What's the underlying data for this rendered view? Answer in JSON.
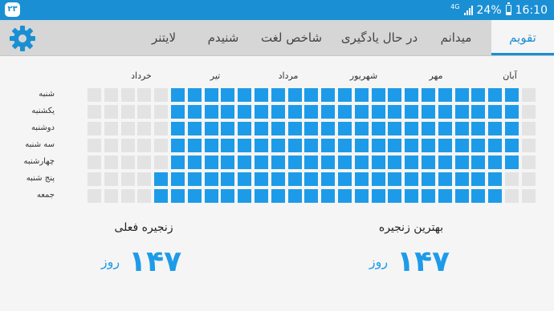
{
  "status_bar": {
    "app_badge": "۲۳",
    "network": "4G",
    "battery": "24%",
    "time": "16:10"
  },
  "tabs": {
    "calendar": "تقویم",
    "did_you_know": "میدانم",
    "learning": "در حال یادگیری",
    "word_index": "شاخص لغت",
    "heard": "شنیدم",
    "leitner": "لایتنر"
  },
  "calendar": {
    "months": {
      "aban": "آبان",
      "mehr": "مهر",
      "shahrivar": "شهریور",
      "mordad": "مرداد",
      "tir": "تیر",
      "khordad": "خرداد"
    },
    "days": {
      "sat": "شنبه",
      "sun": "یکشنبه",
      "mon": "دوشنبه",
      "tue": "سه شنبه",
      "wed": "چهارشنبه",
      "thu": "پنج شنبه",
      "fri": "جمعه"
    }
  },
  "stats": {
    "best_streak_label": "بهترین زنجیره",
    "best_streak_value": "۱۴۷",
    "best_streak_unit": "روز",
    "current_streak_label": "زنجیره فعلی",
    "current_streak_value": "۱۴۷",
    "current_streak_unit": "روز"
  },
  "colors": {
    "accent": "#1a8fd4",
    "active_cell": "#1e9be8",
    "empty_cell": "#e3e3e3"
  }
}
